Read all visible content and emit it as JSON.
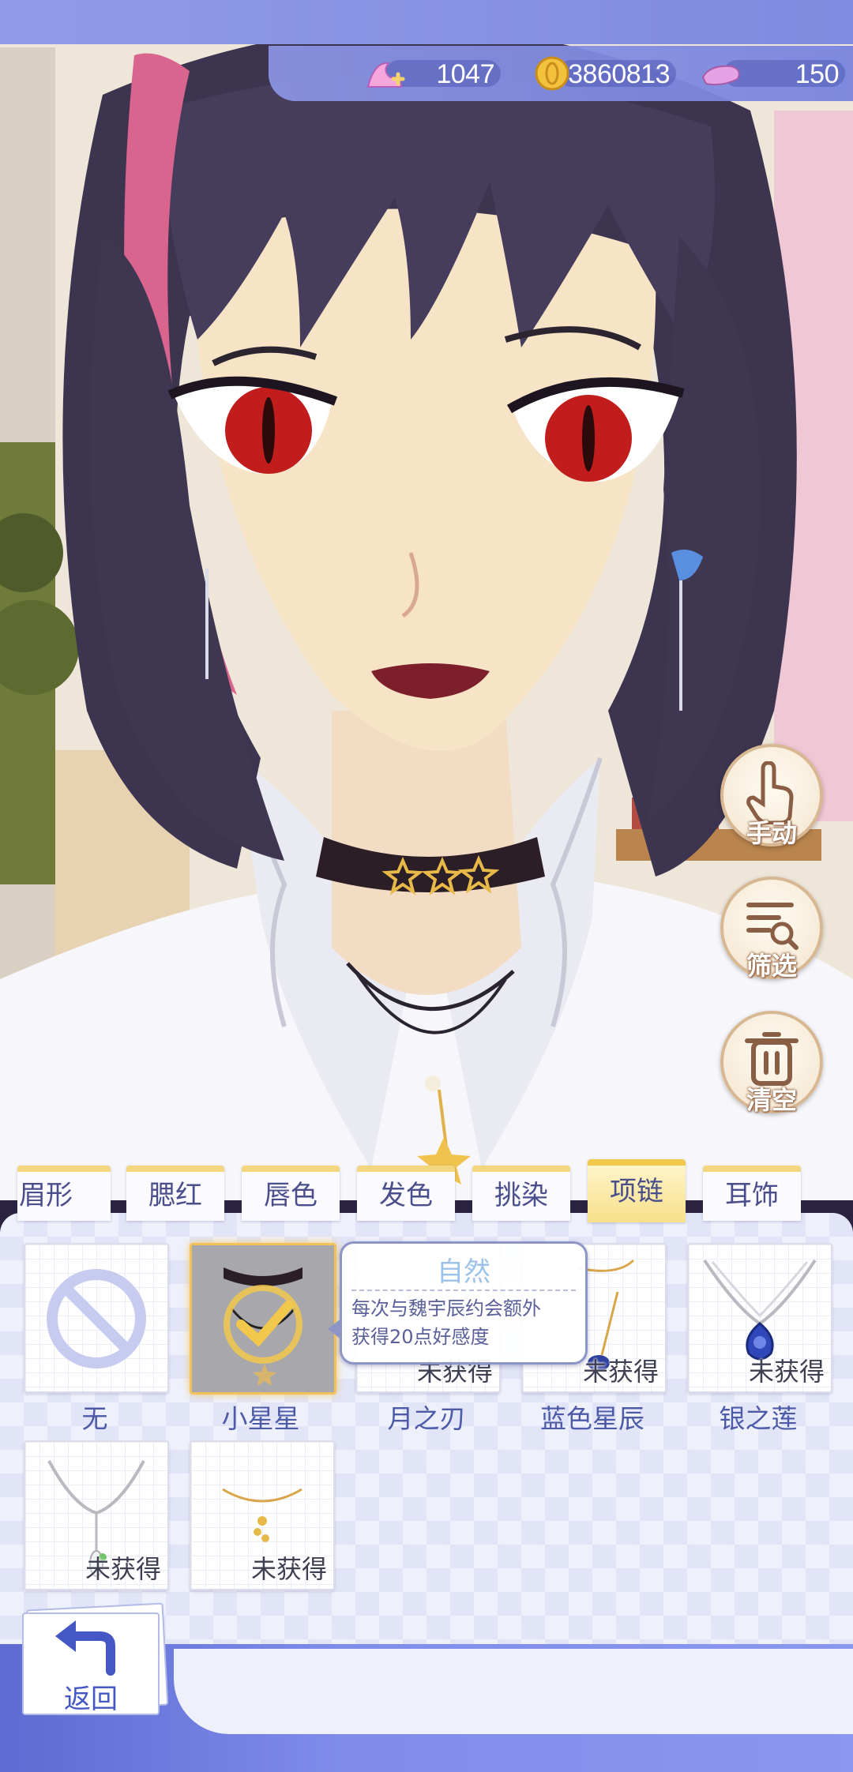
{
  "currency": [
    {
      "icon": "pink-swan-crystal-icon",
      "value": "1047"
    },
    {
      "icon": "gold-coin-icon",
      "value": "3860813"
    },
    {
      "icon": "pink-stamina-icon",
      "value": "150"
    }
  ],
  "side_buttons": [
    {
      "icon": "hand-icon",
      "label": "手动"
    },
    {
      "icon": "filter-icon",
      "label": "筛选"
    },
    {
      "icon": "trash-icon",
      "label": "清空"
    }
  ],
  "tabs": [
    "眉形",
    "腮红",
    "唇色",
    "发色",
    "挑染",
    "项链",
    "耳饰"
  ],
  "active_tab": "项链",
  "items": [
    {
      "name": "无",
      "state": ""
    },
    {
      "name": "小星星",
      "state": "",
      "selected": true
    },
    {
      "name": "月之刃",
      "state": "未获得"
    },
    {
      "name": "蓝色星辰",
      "state": "未获得"
    },
    {
      "name": "银之莲",
      "state": "未获得"
    },
    {
      "name": "",
      "state": "未获得"
    },
    {
      "name": "",
      "state": "未获得"
    }
  ],
  "tooltip": {
    "title": "自然",
    "line1": "每次与魏宇辰约会额外",
    "line2": "获得20点好感度"
  },
  "back_label": "返回",
  "colors": {
    "accent": "#4a4f8c",
    "tab_active": "#f6e08a",
    "panel": "#eef0fb",
    "topbar": "#8f9ae8"
  }
}
